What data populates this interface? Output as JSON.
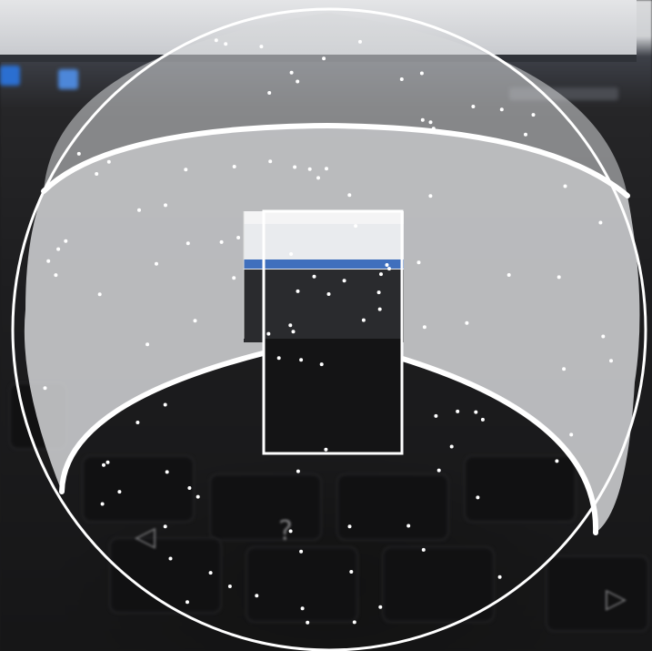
{
  "scene": {
    "description_role": "camera-photo-of-laptop-screen",
    "overlay": "spherical-viewport-guide"
  },
  "overlay": {
    "stroke_color": "#ffffff",
    "band_fill": "rgba(220,220,222,0.78)",
    "cap_fill": "rgba(230,230,232,0.6)",
    "dot_color": "#ffffff",
    "frame_color": "#ffffff"
  },
  "icons": {
    "app_tile": "app-tile-icon",
    "tray": "system-tray-icon"
  },
  "colors": {
    "monitor_bezel": "#2f3238",
    "screen": "#d9dadc",
    "keyboard": "#161617",
    "taskbar_accent": "#2b6fd1"
  }
}
